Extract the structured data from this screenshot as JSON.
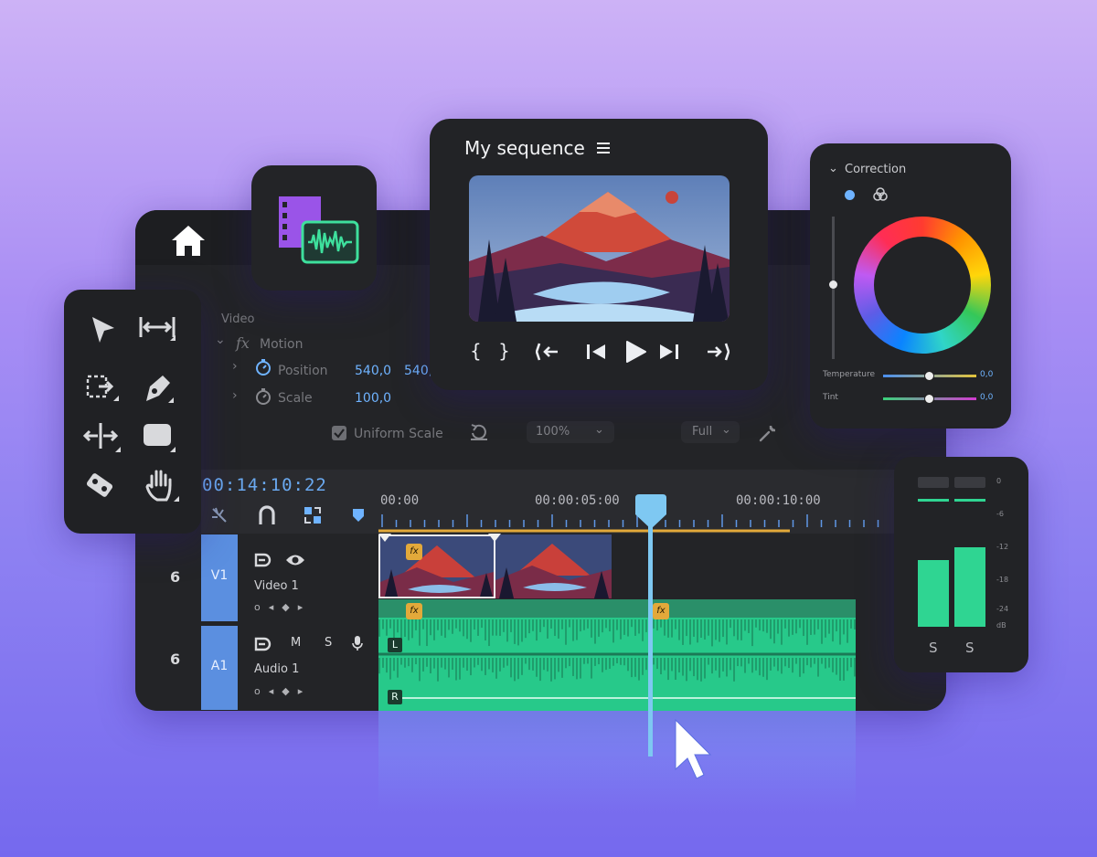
{
  "monitor": {
    "title": "My sequence"
  },
  "effects": {
    "section": "Video",
    "fx_label": "fx",
    "motion": "Motion",
    "position_label": "Position",
    "position_x": "540,0",
    "position_y": "540,",
    "scale_label": "Scale",
    "scale_value": "100,0",
    "uniform_scale": "Uniform Scale",
    "zoom": "100%",
    "quality": "Full"
  },
  "timeline": {
    "timecode": "00:14:10:22",
    "ticks": [
      "00:00",
      "00:00:05:00",
      "00:00:10:00"
    ],
    "video_track": {
      "target": "V1",
      "name": "Video 1",
      "lock": "6"
    },
    "audio_track": {
      "target": "A1",
      "name": "Audio 1",
      "lock": "6",
      "mute": "M",
      "solo": "S"
    },
    "clip_fx": "fx",
    "channel_left": "L",
    "channel_right": "R"
  },
  "color": {
    "title": "Correction",
    "temperature_label": "Temperature",
    "temperature_value": "0,0",
    "tint_label": "Tint",
    "tint_value": "0,0"
  },
  "meter": {
    "scale": [
      "0",
      "-6",
      "-12",
      "-18",
      "-24",
      "dB"
    ],
    "solo_left": "S",
    "solo_right": "S",
    "level_left": 0.56,
    "level_right": 0.67
  },
  "colors": {
    "accent_blue": "#6fb3ff",
    "audio_green": "#2fd592",
    "playhead": "#7ec8f2",
    "clip_gold": "#e3a93a"
  }
}
